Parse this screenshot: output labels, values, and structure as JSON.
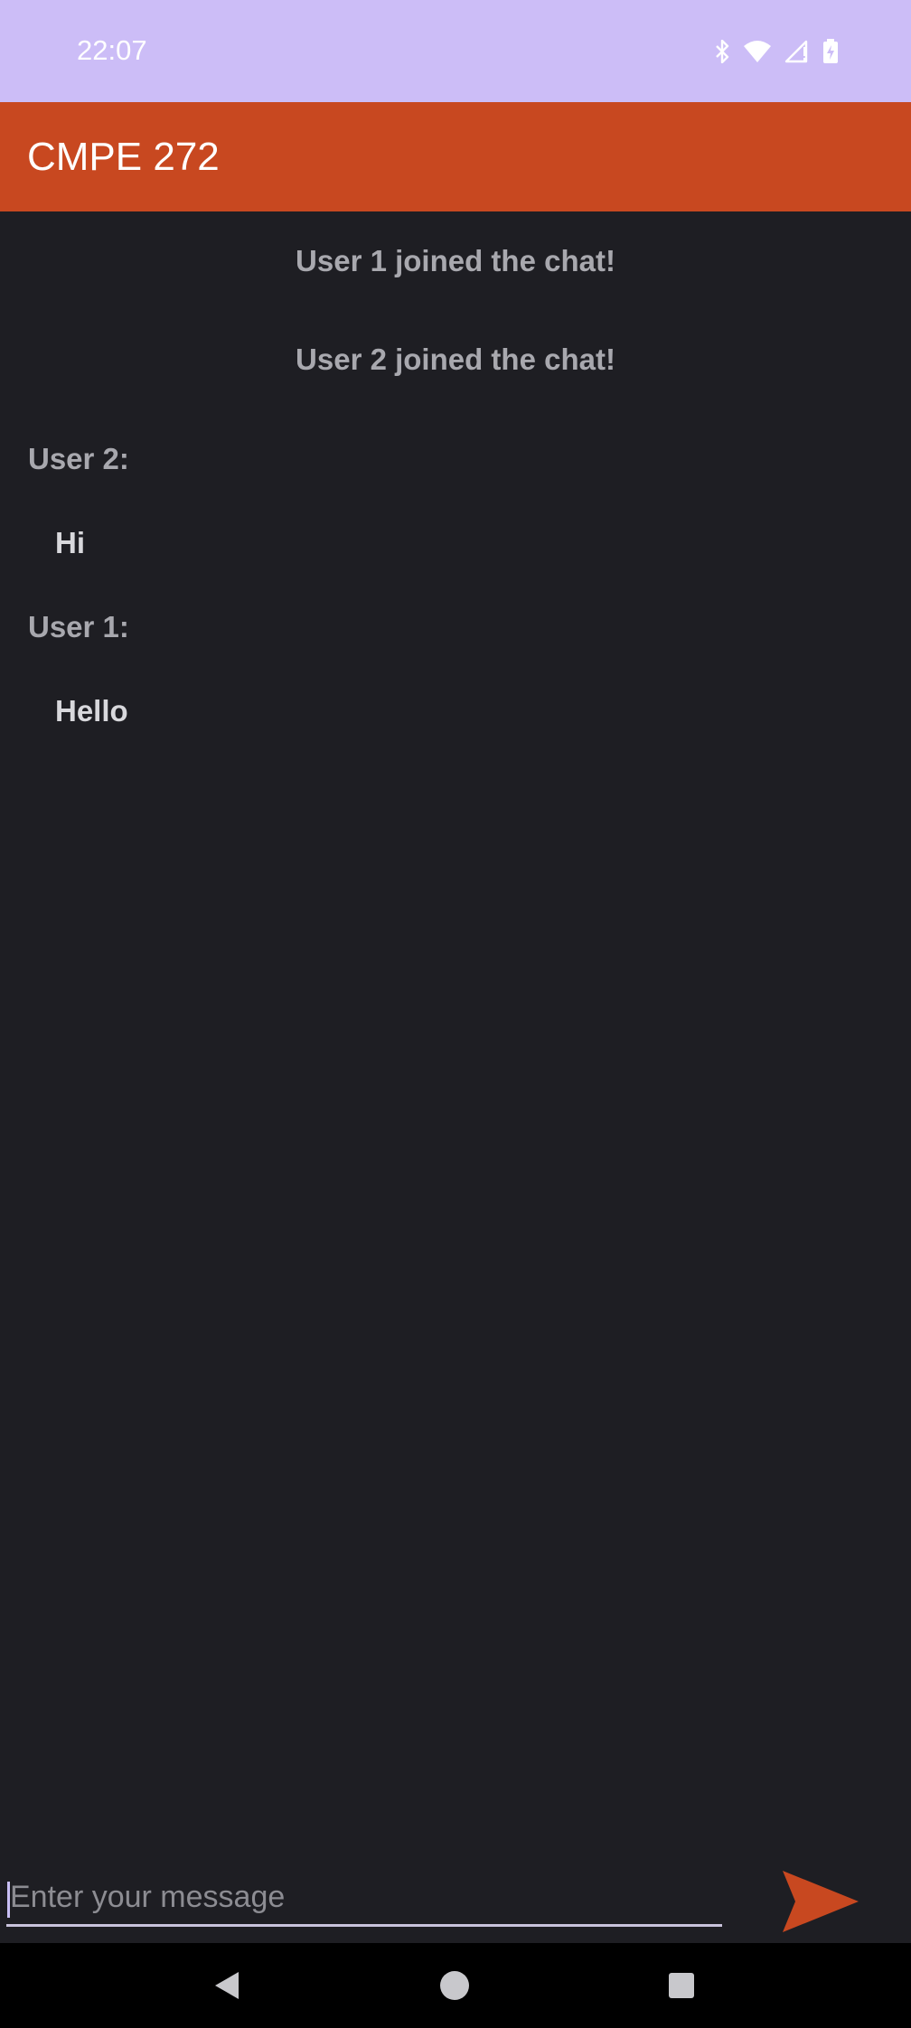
{
  "status_bar": {
    "time": "22:07",
    "icons": [
      "bluetooth-icon",
      "wifi-icon",
      "cell-signal-icon",
      "battery-charging-icon"
    ],
    "background": "#ccbdf7"
  },
  "app_bar": {
    "title": "CMPE 272",
    "background": "#c84820"
  },
  "chat": {
    "system_messages": [
      "User 1 joined the chat!",
      "User 2 joined the chat!"
    ],
    "messages": [
      {
        "sender": "User 2:",
        "text": "Hi"
      },
      {
        "sender": "User 1:",
        "text": "Hello"
      }
    ],
    "background": "#1e1e23"
  },
  "composer": {
    "placeholder": "Enter your message",
    "value": "",
    "send_icon": "send-icon",
    "accent": "#c84820"
  },
  "nav_bar": {
    "icons": [
      "back-icon",
      "home-icon",
      "recents-icon"
    ]
  }
}
